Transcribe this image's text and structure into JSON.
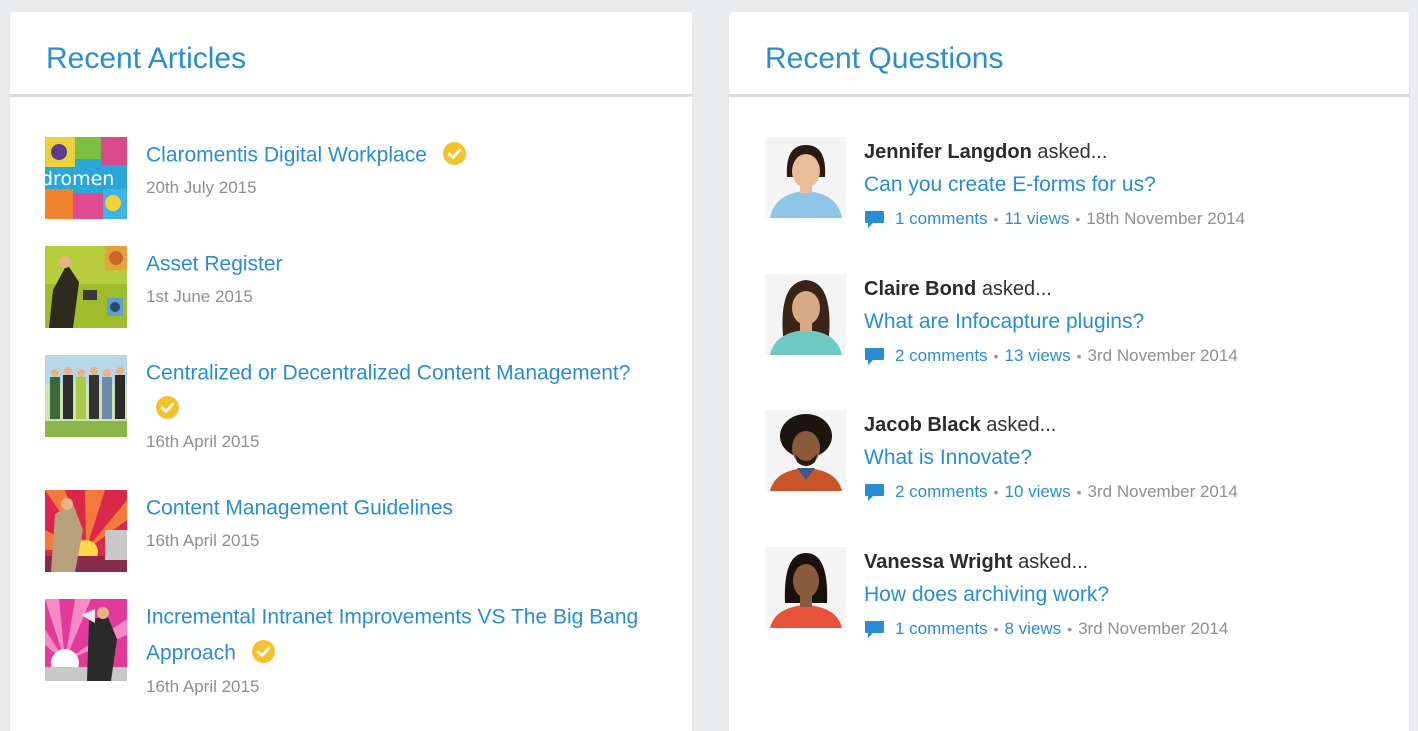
{
  "articles_panel": {
    "title": "Recent Articles",
    "items": [
      {
        "title": "Claromentis Digital Workplace",
        "date": "20th July 2015",
        "verified": true,
        "thumb_text": "dromen"
      },
      {
        "title": "Asset Register",
        "date": "1st June 2015",
        "verified": false
      },
      {
        "title": "Centralized or Decentralized Content Management?",
        "date": "16th April 2015",
        "verified": true
      },
      {
        "title": "Content Management Guidelines",
        "date": "16th April 2015",
        "verified": false
      },
      {
        "title": "Incremental Intranet Improvements VS The Big Bang Approach",
        "date": "16th April 2015",
        "verified": true
      }
    ]
  },
  "questions_panel": {
    "title": "Recent Questions",
    "asked_suffix": "asked...",
    "items": [
      {
        "asker": "Jennifer Langdon",
        "question": "Can you create E-forms for us?",
        "comments": "1 comments",
        "views": "11 views",
        "date": "18th November 2014"
      },
      {
        "asker": "Claire Bond",
        "question": "What are Infocapture plugins?",
        "comments": "2 comments",
        "views": "13 views",
        "date": "3rd November 2014"
      },
      {
        "asker": "Jacob Black",
        "question": "What is Innovate?",
        "comments": "2 comments",
        "views": "10 views",
        "date": "3rd November 2014"
      },
      {
        "asker": "Vanessa Wright",
        "question": "How does archiving work?",
        "comments": "1 comments",
        "views": "8 views",
        "date": "3rd November 2014"
      }
    ],
    "separator": "•"
  },
  "colors": {
    "link": "#2a8dd4",
    "verified": "#f5c12e",
    "muted": "#8f8f8f",
    "background": "#ebeced"
  }
}
